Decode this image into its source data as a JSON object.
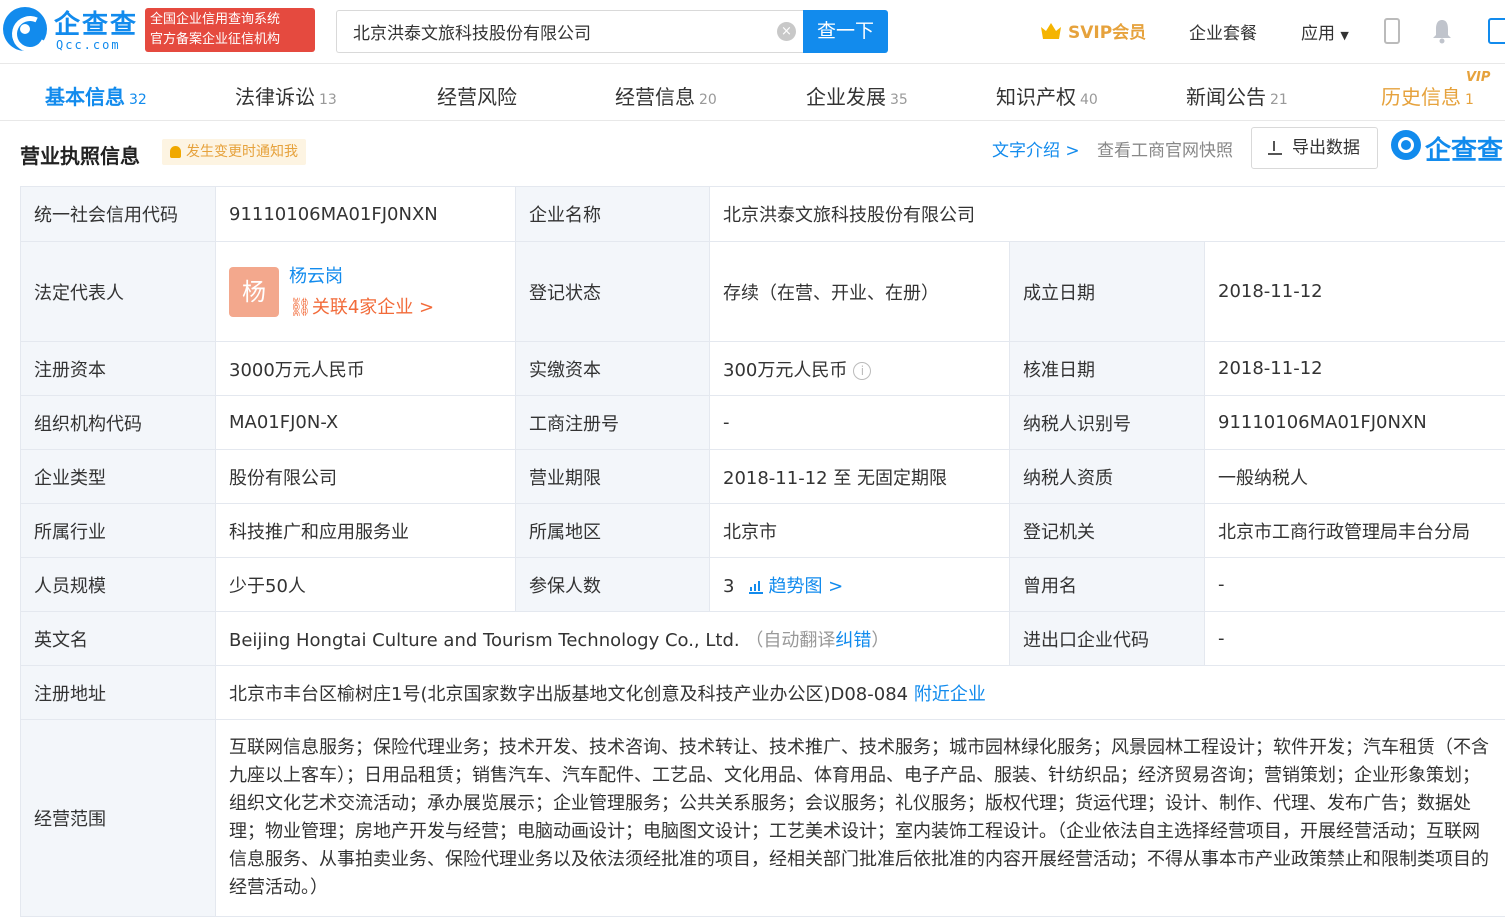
{
  "header": {
    "logo_text": "企查查",
    "logo_sub": "Qcc.com",
    "badge_line1": "全国企业信用查询系统",
    "badge_line2": "官方备案企业征信机构",
    "search_value": "北京洪泰文旅科技股份有限公司",
    "search_button": "查一下",
    "svip": "SVIP会员",
    "nav_package": "企业套餐",
    "nav_apps": "应用"
  },
  "tabs": [
    {
      "label": "基本信息",
      "count": "32"
    },
    {
      "label": "法律诉讼",
      "count": "13"
    },
    {
      "label": "经营风险",
      "count": ""
    },
    {
      "label": "经营信息",
      "count": "20"
    },
    {
      "label": "企业发展",
      "count": "35"
    },
    {
      "label": "知识产权",
      "count": "40"
    },
    {
      "label": "新闻公告",
      "count": "21"
    },
    {
      "label": "历史信息",
      "count": "1"
    }
  ],
  "vip_tag": "VIP",
  "section": {
    "title": "营业执照信息",
    "notify": "发生变更时通知我",
    "text_intro": "文字介绍 >",
    "gov_snapshot": "查看工商官网快照",
    "export": "导出数据",
    "watermark": "企查查"
  },
  "info": {
    "credit_code_label": "统一社会信用代码",
    "credit_code": "91110106MA01FJ0NXN",
    "company_name_label": "企业名称",
    "company_name": "北京洪泰文旅科技股份有限公司",
    "legal_rep_label": "法定代表人",
    "legal_rep_avatar": "杨",
    "legal_rep_name": "杨云岗",
    "legal_rep_related": "关联4家企业 >",
    "reg_status_label": "登记状态",
    "reg_status": "存续（在营、开业、在册）",
    "found_date_label": "成立日期",
    "found_date": "2018-11-12",
    "reg_capital_label": "注册资本",
    "reg_capital": "3000万元人民币",
    "paid_capital_label": "实缴资本",
    "paid_capital": "300万元人民币",
    "approve_date_label": "核准日期",
    "approve_date": "2018-11-12",
    "org_code_label": "组织机构代码",
    "org_code": "MA01FJ0N-X",
    "biz_reg_no_label": "工商注册号",
    "biz_reg_no": "-",
    "taxpayer_id_label": "纳税人识别号",
    "taxpayer_id": "91110106MA01FJ0NXN",
    "company_type_label": "企业类型",
    "company_type": "股份有限公司",
    "biz_term_label": "营业期限",
    "biz_term": "2018-11-12 至 无固定期限",
    "taxpayer_qual_label": "纳税人资质",
    "taxpayer_qual": "一般纳税人",
    "industry_label": "所属行业",
    "industry": "科技推广和应用服务业",
    "region_label": "所属地区",
    "region": "北京市",
    "reg_authority_label": "登记机关",
    "reg_authority": "北京市工商行政管理局丰台分局",
    "staff_size_label": "人员规模",
    "staff_size": "少于50人",
    "insured_label": "参保人数",
    "insured": "3",
    "trend": "趋势图 >",
    "former_name_label": "曾用名",
    "former_name": "-",
    "english_name_label": "英文名",
    "english_name": "Beijing Hongtai Culture and Tourism Technology Co., Ltd.",
    "auto_translate_open": "（自动翻译",
    "correct": "纠错",
    "auto_translate_close": "）",
    "import_export_label": "进出口企业代码",
    "import_export": "-",
    "address_label": "注册地址",
    "address": "北京市丰台区榆树庄1号(北京国家数字出版基地文化创意及科技产业办公区)D08-084",
    "nearby": "附近企业",
    "scope_label": "经营范围",
    "scope": "互联网信息服务；保险代理业务；技术开发、技术咨询、技术转让、技术推广、技术服务；城市园林绿化服务；风景园林工程设计；软件开发；汽车租赁（不含九座以上客车）；日用品租赁；销售汽车、汽车配件、工艺品、文化用品、体育用品、电子产品、服装、针纺织品；经济贸易咨询；营销策划；企业形象策划；组织文化艺术交流活动；承办展览展示；企业管理服务；公共关系服务；会议服务；礼仪服务；版权代理；货运代理；设计、制作、代理、发布广告；数据处理；物业管理；房地产开发与经营；电脑动画设计；电脑图文设计；工艺美术设计；室内装饰工程设计。（企业依法自主选择经营项目，开展经营活动；互联网信息服务、从事拍卖业务、保险代理业务以及依法须经批准的项目，经相关部门批准后依批准的内容开展经营活动；不得从事本市产业政策禁止和限制类项目的经营活动。）"
  }
}
